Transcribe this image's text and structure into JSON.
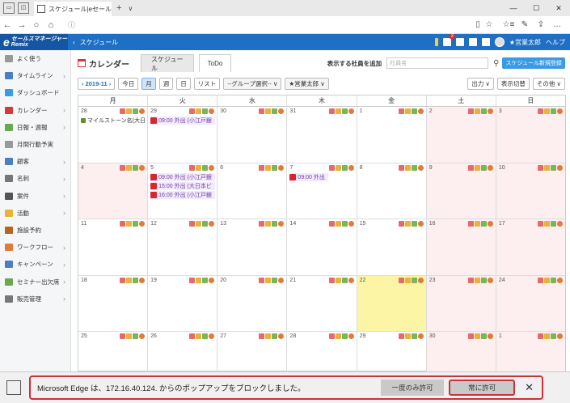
{
  "browser": {
    "tab_title": "スケジュール|eセールスマネー",
    "tab_add": "+",
    "tab_list": "∨",
    "win_controls": [
      "—",
      "☐",
      "✕"
    ],
    "nav": [
      "←",
      "→",
      "○",
      "⌂"
    ],
    "url_icon": "ⓘ",
    "url_text": "",
    "tools": [
      "☆",
      "☆≡",
      "✎",
      "⇪",
      "…"
    ]
  },
  "app": {
    "logo_main": "セールスマネージャー",
    "logo_sub": "Remix",
    "breadcrumb_arrow": "‹",
    "breadcrumb": "スケジュール",
    "notification_count": "3",
    "user_name": "★営業太郎",
    "help": "ヘルプ"
  },
  "sidebar": {
    "items": [
      {
        "label": "よく使う",
        "color": "#999999",
        "chevron": false
      },
      {
        "label": "タイムライン",
        "color": "#4a7fc1",
        "chevron": true
      },
      {
        "label": "ダッシュボード",
        "color": "#3a9be3",
        "chevron": false
      },
      {
        "label": "カレンダー",
        "color": "#d33b3b",
        "chevron": true
      },
      {
        "label": "日報・週報",
        "color": "#6aa84f",
        "chevron": true
      },
      {
        "label": "月間行動予実",
        "color": "#999999",
        "chevron": false
      },
      {
        "label": "顧客",
        "color": "#4a7fc1",
        "chevron": true
      },
      {
        "label": "名刺",
        "color": "#777777",
        "chevron": true
      },
      {
        "label": "案件",
        "color": "#555555",
        "chevron": true
      },
      {
        "label": "活動",
        "color": "#e8b23b",
        "chevron": true
      },
      {
        "label": "施設予約",
        "color": "#b5651d",
        "chevron": false
      },
      {
        "label": "ワークフロー",
        "color": "#e07c3a",
        "chevron": true
      },
      {
        "label": "キャンペーン",
        "color": "#4a7fc1",
        "chevron": true
      },
      {
        "label": "セミナー出欠席",
        "color": "#6aa84f",
        "chevron": true
      },
      {
        "label": "販売管理",
        "color": "#777777",
        "chevron": true
      }
    ]
  },
  "calendar": {
    "title": "カレンダー",
    "tab_schedule": "スケジュール",
    "tab_todo": "ToDo",
    "add_employee_label": "表示する社員を追加",
    "employee_placeholder": "社員名",
    "new_button": "スケジュール新規登録",
    "date_label": "‹ 2019-11 ›",
    "today": "今日",
    "view_month": "月",
    "view_week": "週",
    "view_day": "日",
    "view_list": "リスト",
    "group_select": "--グループ選択-- ∨",
    "user_select": "★営業太郎 ∨",
    "output": "出力 ∨",
    "display_switch": "表示切替",
    "other": "その他 ∨",
    "weekdays": [
      "月",
      "火",
      "水",
      "木",
      "金",
      "土",
      "日"
    ],
    "weeks": [
      [
        {
          "d": "28",
          "bg": "white",
          "events": [
            {
              "t": "マイルストーン名(大日",
              "kind": "ms"
            }
          ]
        },
        {
          "d": "29",
          "bg": "white",
          "events": [
            {
              "t": "09:00 外出 (小江戸銀",
              "kind": "out"
            }
          ]
        },
        {
          "d": "30",
          "bg": "white",
          "events": []
        },
        {
          "d": "31",
          "bg": "white",
          "events": []
        },
        {
          "d": "1",
          "bg": "white",
          "events": []
        },
        {
          "d": "2",
          "bg": "pink",
          "events": []
        },
        {
          "d": "3",
          "bg": "pink",
          "events": []
        }
      ],
      [
        {
          "d": "4",
          "bg": "pink",
          "events": []
        },
        {
          "d": "5",
          "bg": "white",
          "events": [
            {
              "t": "09:00 外出 (小江戸銀",
              "kind": "out"
            },
            {
              "t": "15:00 外出 (大日本ビ",
              "kind": "out"
            },
            {
              "t": "16:00 外出 (小江戸銀",
              "kind": "out"
            }
          ]
        },
        {
          "d": "6",
          "bg": "white",
          "events": []
        },
        {
          "d": "7",
          "bg": "white",
          "events": [
            {
              "t": "09:00 外出",
              "kind": "out"
            }
          ]
        },
        {
          "d": "8",
          "bg": "white",
          "events": []
        },
        {
          "d": "9",
          "bg": "pink",
          "events": []
        },
        {
          "d": "10",
          "bg": "pink",
          "events": []
        }
      ],
      [
        {
          "d": "11",
          "bg": "white",
          "events": []
        },
        {
          "d": "12",
          "bg": "white",
          "events": []
        },
        {
          "d": "13",
          "bg": "white",
          "events": []
        },
        {
          "d": "14",
          "bg": "white",
          "events": []
        },
        {
          "d": "15",
          "bg": "white",
          "events": []
        },
        {
          "d": "16",
          "bg": "pink",
          "events": []
        },
        {
          "d": "17",
          "bg": "pink",
          "events": []
        }
      ],
      [
        {
          "d": "18",
          "bg": "white",
          "events": []
        },
        {
          "d": "19",
          "bg": "white",
          "events": []
        },
        {
          "d": "20",
          "bg": "white",
          "events": []
        },
        {
          "d": "21",
          "bg": "white",
          "events": []
        },
        {
          "d": "22",
          "bg": "today",
          "events": []
        },
        {
          "d": "23",
          "bg": "pink",
          "events": []
        },
        {
          "d": "24",
          "bg": "pink",
          "events": []
        }
      ],
      [
        {
          "d": "25",
          "bg": "white",
          "events": []
        },
        {
          "d": "26",
          "bg": "white",
          "events": []
        },
        {
          "d": "27",
          "bg": "white",
          "events": []
        },
        {
          "d": "28",
          "bg": "white",
          "events": []
        },
        {
          "d": "29",
          "bg": "white",
          "events": []
        },
        {
          "d": "30",
          "bg": "pink",
          "events": []
        },
        {
          "d": "1",
          "bg": "pink",
          "events": []
        }
      ]
    ]
  },
  "popup": {
    "message": "Microsoft Edge は、172.16.40.124. からのポップアップをブロックしました。",
    "allow_once": "一度のみ許可",
    "always_allow": "常に許可",
    "close": "✕"
  }
}
